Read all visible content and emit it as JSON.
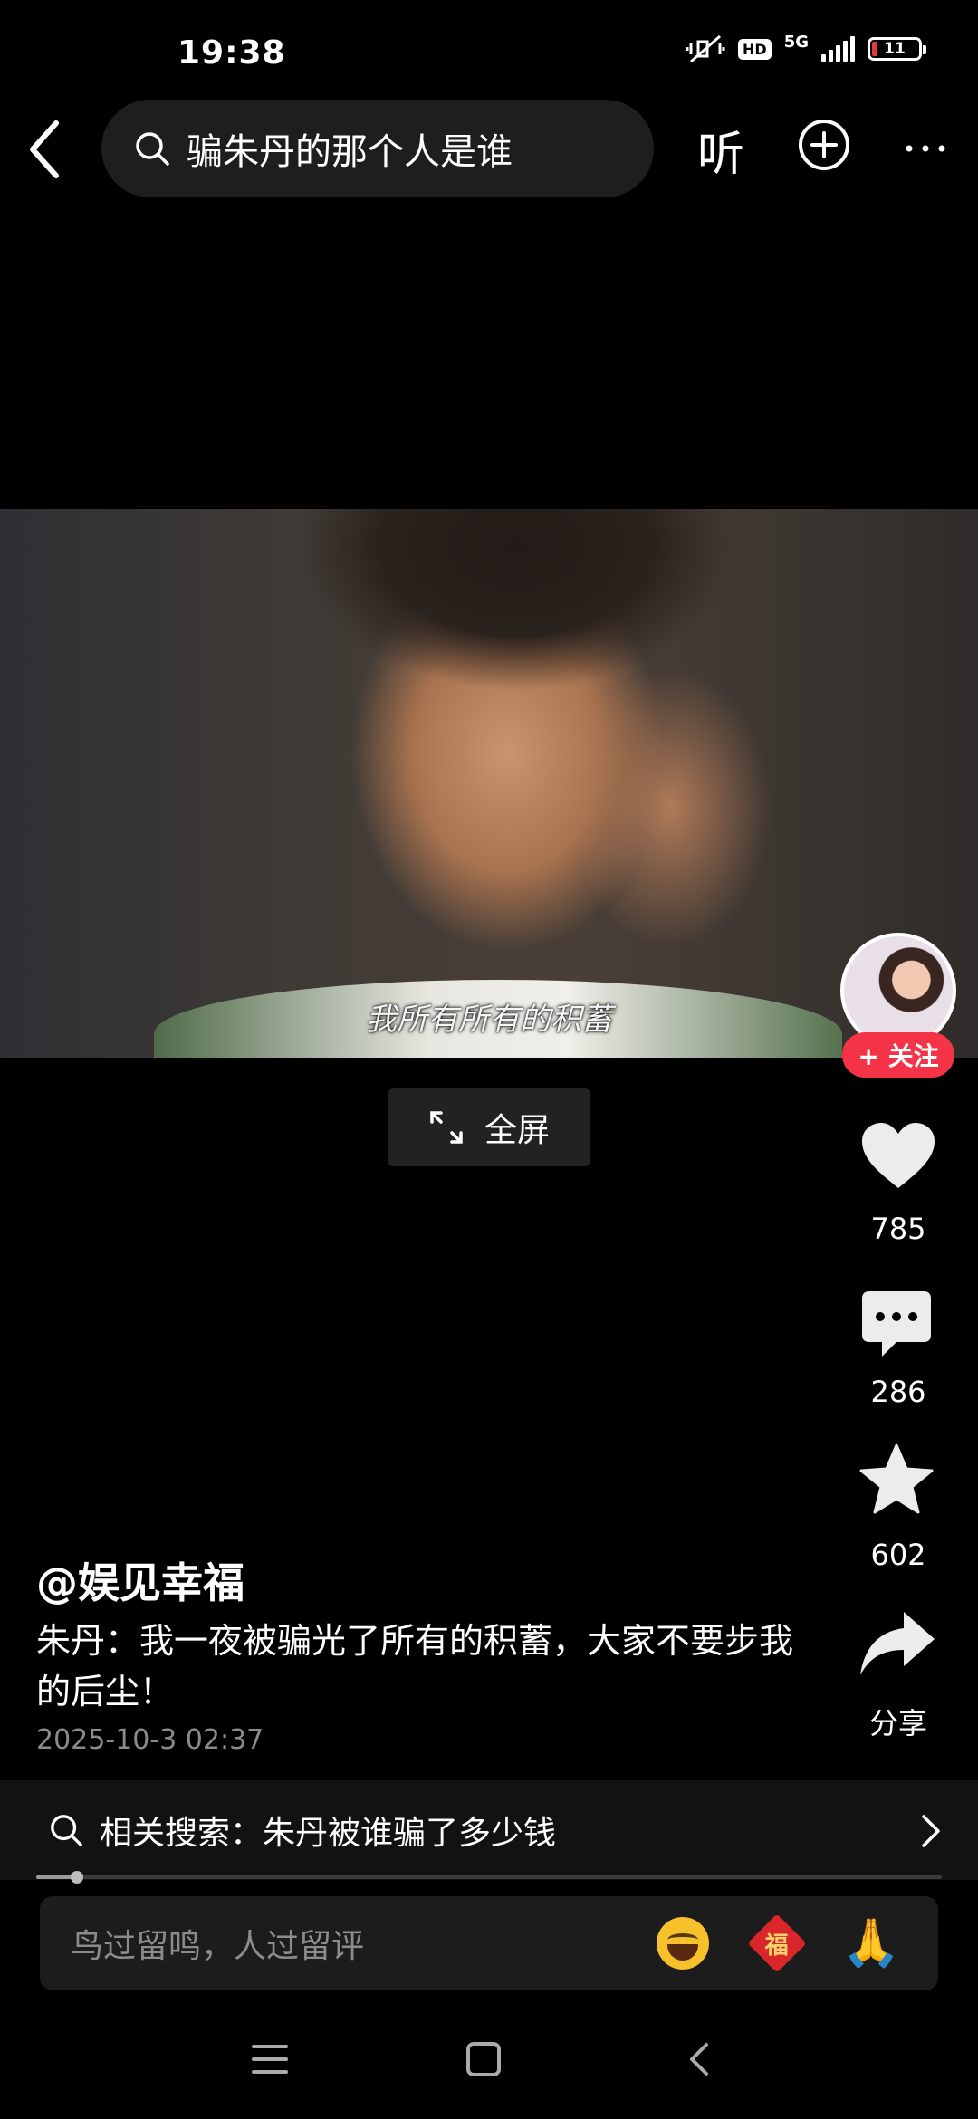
{
  "status_bar": {
    "time": "19:38",
    "hd": "HD",
    "network": "5G",
    "battery": "11"
  },
  "header": {
    "search_query": "骗朱丹的那个人是谁",
    "listen_label": "听"
  },
  "video": {
    "subtitle": "我所有所有的积蓄",
    "fullscreen_label": "全屏"
  },
  "right_rail": {
    "follow_label": "+ 关注",
    "likes": "785",
    "comments": "286",
    "favorites": "602",
    "share_label": "分享"
  },
  "post": {
    "author": "@娱见幸福",
    "caption": "朱丹：我一夜被骗光了所有的积蓄，大家不要步我的后尘！",
    "timestamp": "2025-10-3 02:37"
  },
  "related_search": {
    "text": "相关搜索：朱丹被谁骗了多少钱"
  },
  "playback": {
    "progress_fraction": 0.045
  },
  "comment_bar": {
    "placeholder": "鸟过留鸣，人过留评",
    "fu_char": "福",
    "pray_emoji": "🙏"
  },
  "colors": {
    "accent_follow": "#f53347",
    "background": "#000000",
    "battery_low": "#e23a3a"
  }
}
